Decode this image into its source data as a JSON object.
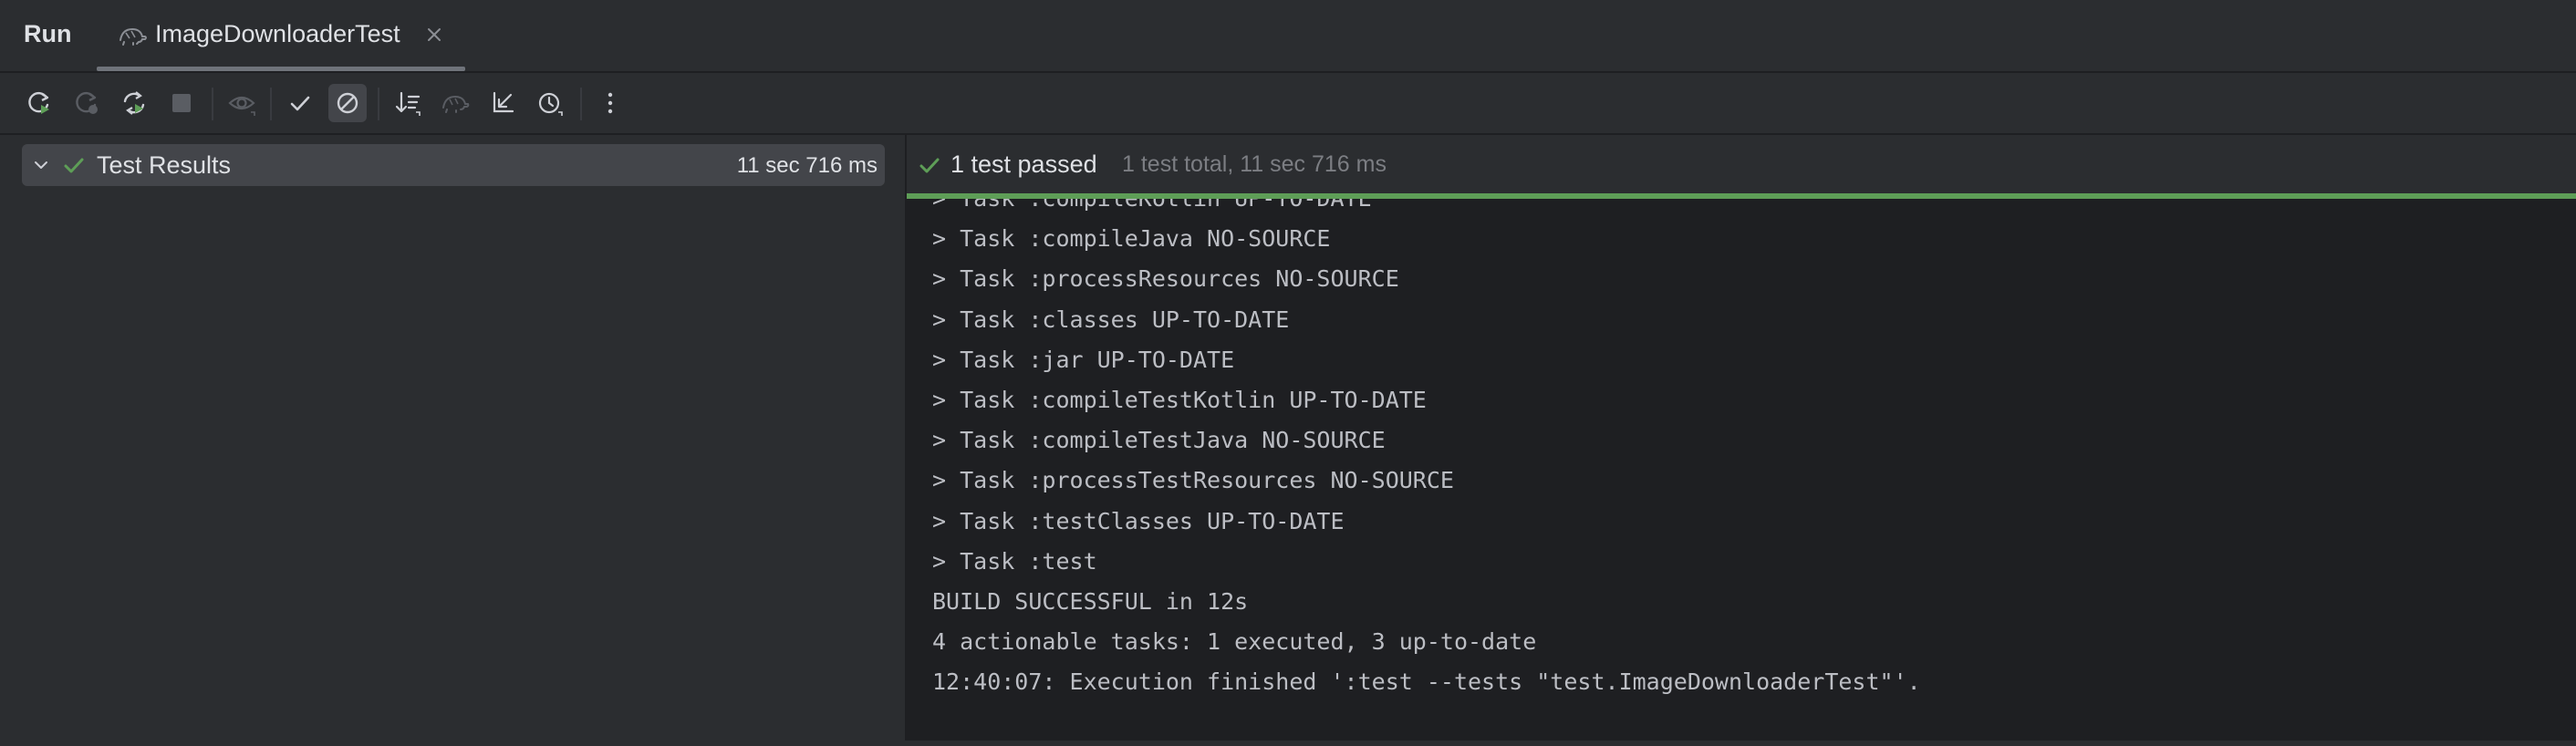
{
  "header": {
    "run_title": "Run",
    "tab": {
      "label": "ImageDownloaderTest",
      "icon": "turtle-icon"
    }
  },
  "toolbar": {
    "buttons": [
      {
        "name": "rerun-icon",
        "enabled": true
      },
      {
        "name": "rerun-failed-icon",
        "enabled": false
      },
      {
        "name": "rerun-auto-icon",
        "enabled": true
      },
      {
        "name": "stop-icon",
        "enabled": false
      },
      {
        "name": "eye-icon",
        "enabled": false
      },
      {
        "name": "check-icon",
        "enabled": true
      },
      {
        "name": "cancel-circle-icon",
        "enabled": true,
        "selected": true
      },
      {
        "name": "sort-icon",
        "enabled": true
      },
      {
        "name": "turtle-icon",
        "enabled": false
      },
      {
        "name": "collapse-icon",
        "enabled": true
      },
      {
        "name": "clock-icon",
        "enabled": true
      },
      {
        "name": "more-icon",
        "enabled": true
      }
    ]
  },
  "tree": {
    "root_label": "Test Results",
    "root_time": "11 sec 716 ms"
  },
  "status": {
    "text": "1 test passed",
    "detail": "1 test total, 11 sec 716 ms",
    "progress_fraction": 1.0,
    "success_color": "#5e9e57"
  },
  "console": {
    "lines": [
      "> Task :compileKotlin UP-TO-DATE",
      "> Task :compileJava NO-SOURCE",
      "> Task :processResources NO-SOURCE",
      "> Task :classes UP-TO-DATE",
      "> Task :jar UP-TO-DATE",
      "> Task :compileTestKotlin UP-TO-DATE",
      "> Task :compileTestJava NO-SOURCE",
      "> Task :processTestResources NO-SOURCE",
      "> Task :testClasses UP-TO-DATE",
      "> Task :test",
      "BUILD SUCCESSFUL in 12s",
      "4 actionable tasks: 1 executed, 3 up-to-date",
      "12:40:07: Execution finished ':test --tests \"test.ImageDownloaderTest\"'."
    ]
  }
}
